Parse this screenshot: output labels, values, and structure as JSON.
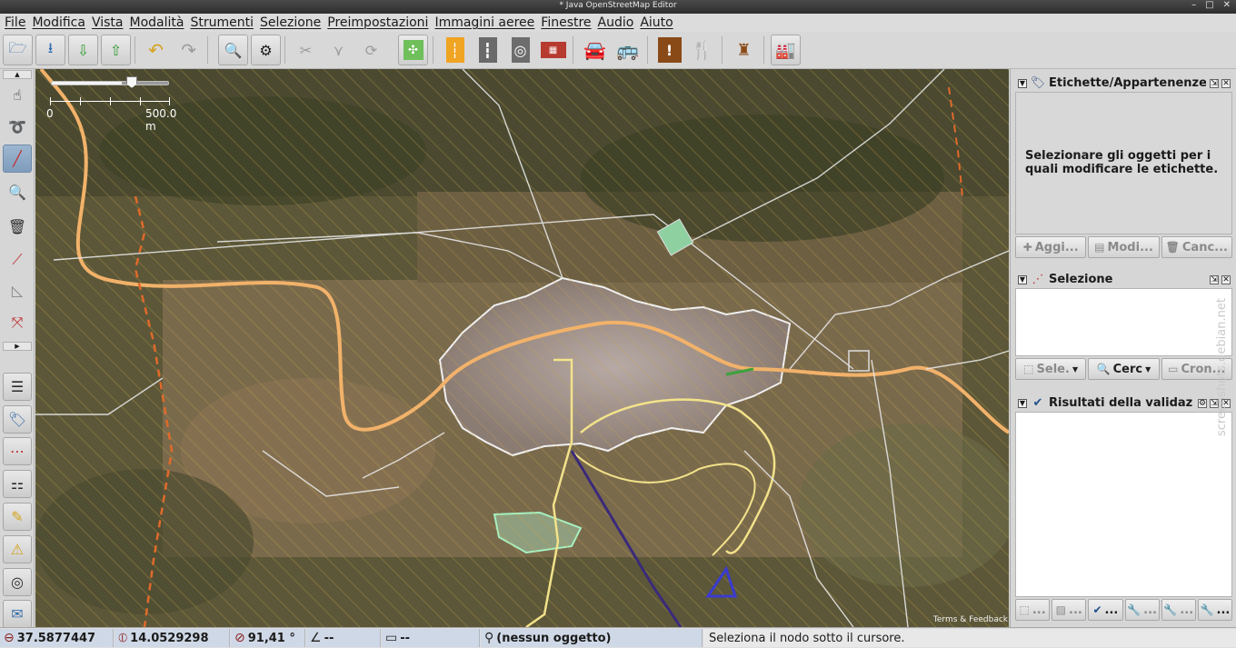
{
  "window": {
    "title": "* Java OpenStreetMap Editor"
  },
  "menubar": [
    "File",
    "Modifica",
    "Vista",
    "Modalità",
    "Strumenti",
    "Selezione",
    "Preimpostazioni",
    "Immagini aeree",
    "Finestre",
    "Audio",
    "Aiuto"
  ],
  "toolbar": {
    "icons": [
      "open-file-icon",
      "save-icon",
      "download-icon",
      "upload-icon",
      "undo-icon",
      "redo-icon",
      "search-preset-icon",
      "preferences-icon",
      "split-way-icon",
      "combine-way-icon",
      "reverse-icon",
      "orthogonalize-icon",
      "road-icon",
      "rail-icon",
      "traffic-signal-icon",
      "wall-icon",
      "car-icon",
      "bus-icon",
      "warning-icon",
      "restaurant-icon",
      "castle-icon",
      "factory-icon"
    ]
  },
  "map": {
    "scale_min": "0",
    "scale_max": "500.0 m",
    "attribution": "Terms & Feedback"
  },
  "panels": {
    "tags": {
      "title": "Etichette/Appartenenze",
      "message": "Selezionare gli oggetti per i quali modificare le etichette.",
      "buttons": [
        "Aggi...",
        "Modi...",
        "Canc..."
      ]
    },
    "selection": {
      "title": "Selezione",
      "buttons": [
        "Sele.",
        "Cerc",
        "Cron..."
      ]
    },
    "validation": {
      "title": "Risultati della validaz",
      "buttons": [
        "...",
        "...",
        "...",
        "...",
        "...",
        "..."
      ]
    }
  },
  "status": {
    "lat": "37.5877447",
    "lon": "14.0529298",
    "heading": "91,41 °",
    "angle": "--",
    "distance": "--",
    "object": "(nessun oggetto)",
    "help": "Seleziona il nodo sotto il cursore."
  },
  "watermark": "screenshots.debian.net"
}
